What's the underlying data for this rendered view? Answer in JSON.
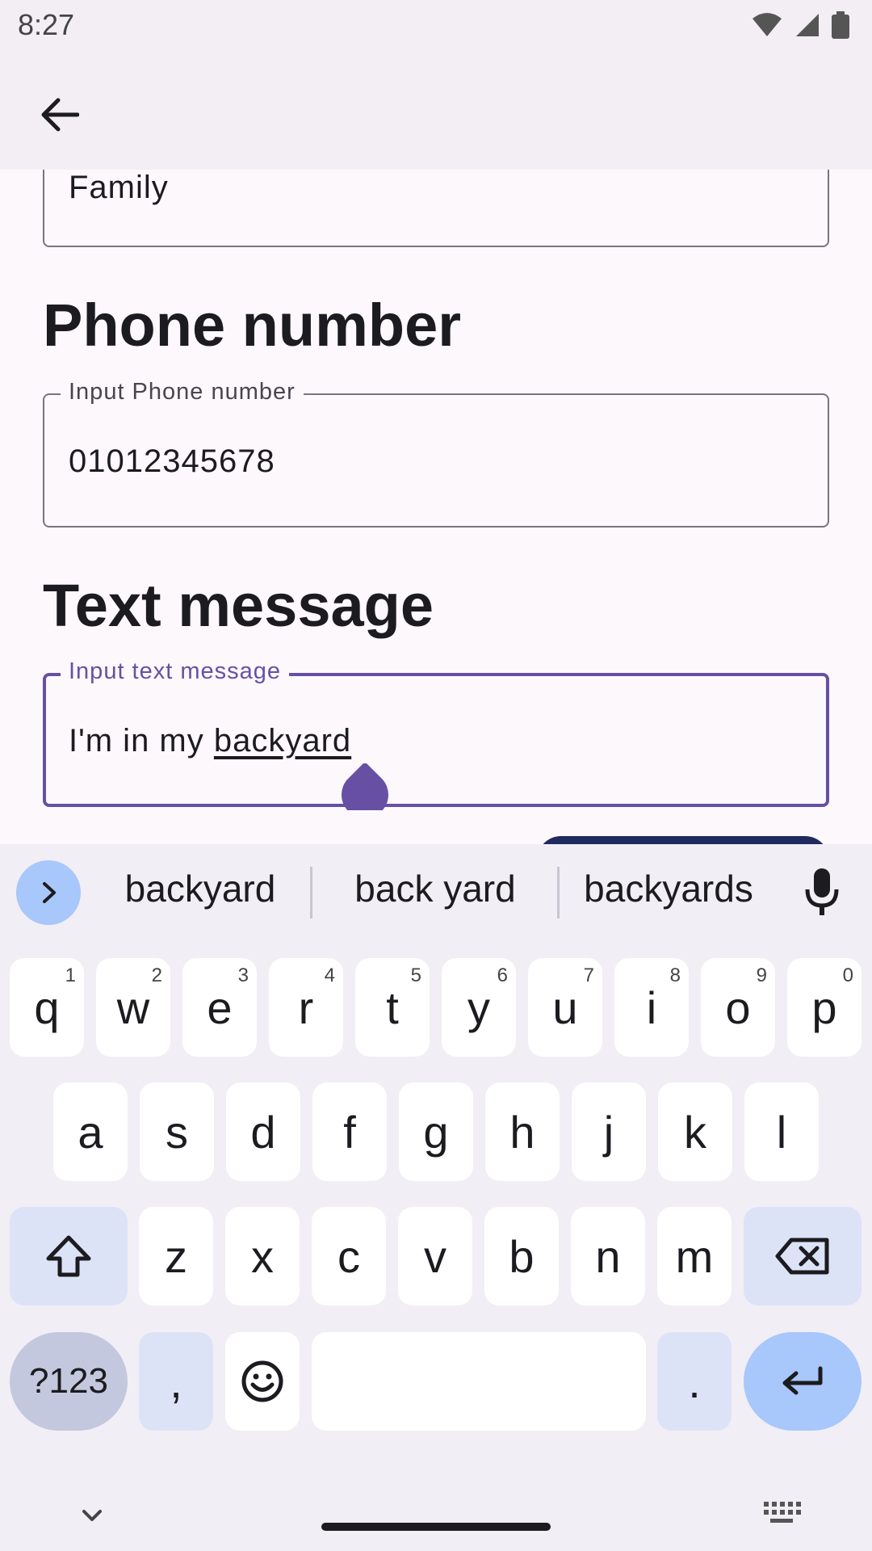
{
  "status": {
    "time": "8:27"
  },
  "form": {
    "family_value": "Family",
    "phone_title": "Phone number",
    "phone_label": "Input Phone number",
    "phone_value": "01012345678",
    "message_title": "Text message",
    "message_label": "Input text message",
    "message_prefix": "I'm in my ",
    "message_composing": "backyard"
  },
  "keyboard": {
    "suggestions": [
      "backyard",
      "back yard",
      "backyards"
    ],
    "row1": [
      {
        "k": "q",
        "h": "1"
      },
      {
        "k": "w",
        "h": "2"
      },
      {
        "k": "e",
        "h": "3"
      },
      {
        "k": "r",
        "h": "4"
      },
      {
        "k": "t",
        "h": "5"
      },
      {
        "k": "y",
        "h": "6"
      },
      {
        "k": "u",
        "h": "7"
      },
      {
        "k": "i",
        "h": "8"
      },
      {
        "k": "o",
        "h": "9"
      },
      {
        "k": "p",
        "h": "0"
      }
    ],
    "row2": [
      "a",
      "s",
      "d",
      "f",
      "g",
      "h",
      "j",
      "k",
      "l"
    ],
    "row3": [
      "z",
      "x",
      "c",
      "v",
      "b",
      "n",
      "m"
    ],
    "symbols_label": "?123",
    "comma_label": ",",
    "period_label": "."
  },
  "colors": {
    "accent": "#6750a4",
    "suggest_accent": "#a8c7fa",
    "modifier_key": "#dde3f7",
    "button_dark": "#1f2b5e"
  },
  "icons": [
    "back-arrow-icon",
    "wifi-icon",
    "signal-icon",
    "battery-icon",
    "chevron-right-icon",
    "mic-icon",
    "shift-icon",
    "backspace-icon",
    "emoji-icon",
    "enter-icon",
    "chevron-down-icon",
    "keyboard-icon"
  ]
}
